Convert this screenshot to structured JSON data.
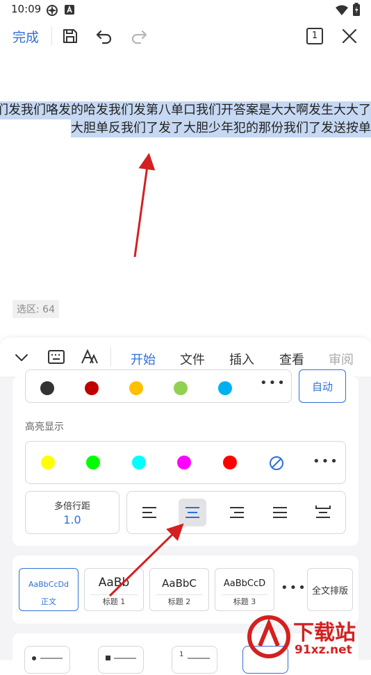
{
  "status_bar": {
    "time": "10:09",
    "icons": [
      "gear-status-icon",
      "a-status-icon",
      "wifi-icon",
      "battery-icon"
    ]
  },
  "toolbar": {
    "done_label": "完成",
    "icons": [
      "save-icon",
      "undo-icon",
      "redo-icon",
      "page-count-icon",
      "close-icon"
    ],
    "page_count": "1"
  },
  "document": {
    "line1": "们发我们咯发的哈发我们发第八单口我们开答案是大大啊发生大大了",
    "line2": "大胆单反我们了发了大胆少年犯的那份我们了发送按单",
    "selection_badge": "选区: 64"
  },
  "panel": {
    "tabs": [
      "开始",
      "文件",
      "插入",
      "查看",
      "审阅"
    ],
    "active_tab": "开始",
    "font_colors": [
      "#333333",
      "#c00000",
      "#ffc000",
      "#92d050",
      "#00b0f0"
    ],
    "auto_label": "自动",
    "highlight_label": "高亮显示",
    "highlight_colors": [
      "#ffff00",
      "#00ff00",
      "#00ffff",
      "#ff00ff",
      "#ff0000"
    ],
    "line_spacing_label": "多倍行距",
    "line_spacing_value": "1.0",
    "alignment": [
      "left",
      "center",
      "right",
      "justify",
      "distributed"
    ],
    "active_alignment": "center",
    "styles": [
      {
        "sample": "AaBbCcDd",
        "name": "正文"
      },
      {
        "sample": "AaBb",
        "name": "标题 1"
      },
      {
        "sample": "AaBbC",
        "name": "标题 2"
      },
      {
        "sample": "AaBbCcD",
        "name": "标题 3"
      }
    ],
    "layout_label": "全文排版"
  },
  "watermark": {
    "text_cn": "下载站",
    "text_url": "91xz.net"
  },
  "colors": {
    "accent": "#2f6fd6",
    "selection": "#c6d8f2",
    "arrow": "#d42020"
  }
}
